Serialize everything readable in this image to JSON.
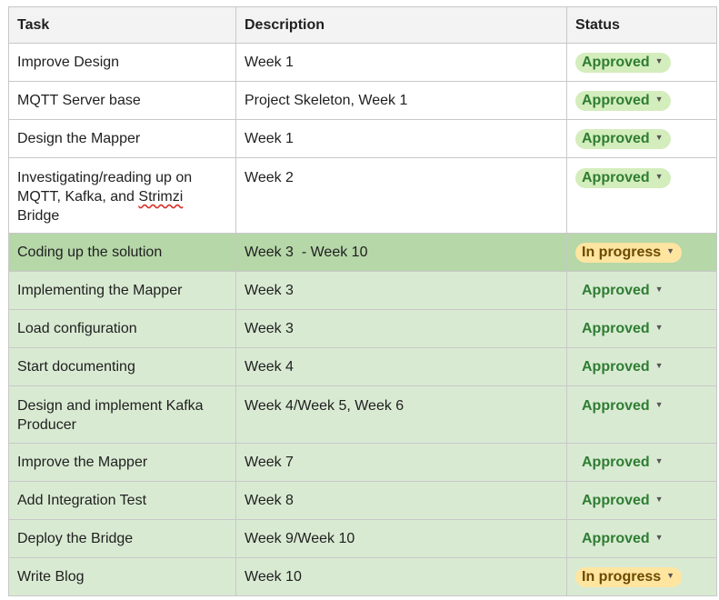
{
  "headers": {
    "task": "Task",
    "description": "Description",
    "status": "Status"
  },
  "rows": [
    {
      "task": "Improve Design",
      "description": "Week 1",
      "status": "Approved"
    },
    {
      "task": "MQTT Server base",
      "description": "Project Skeleton, Week 1",
      "status": "Approved"
    },
    {
      "task": "Design the Mapper",
      "description": "Week 1",
      "status": "Approved"
    },
    {
      "task_a": "Investigating/reading up on MQTT, Kafka, and ",
      "task_b": "Strimzi",
      "task_c": " Bridge",
      "description": "Week 2",
      "status": "Approved"
    },
    {
      "task": "Coding up the solution",
      "description": "Week 3  - Week 10",
      "status": "In progress"
    },
    {
      "task": "Implementing the Mapper",
      "description": "Week 3",
      "status": "Approved"
    },
    {
      "task": "Load configuration",
      "description": "Week 3",
      "status": "Approved"
    },
    {
      "task": "Start documenting",
      "description": "Week 4",
      "status": "Approved"
    },
    {
      "task": "Design and implement Kafka Producer",
      "description": "Week 4/Week 5, Week 6",
      "status": "Approved"
    },
    {
      "task": "Improve the Mapper",
      "description": "Week 7",
      "status": "Approved"
    },
    {
      "task": "Add Integration Test",
      "description": "Week 8",
      "status": "Approved"
    },
    {
      "task": "Deploy the Bridge",
      "description": "Week 9/Week 10",
      "status": "Approved"
    },
    {
      "task": "Write Blog",
      "description": "Week 10",
      "status": "In progress"
    }
  ],
  "colors": {
    "approved_chip": "#d4edbc",
    "in_progress_chip": "#ffe5a0",
    "highlight_row": "#d9ead3",
    "highlight_row_strong": "#b6d7a8"
  },
  "icons": {
    "dropdown": "chevron-down-icon"
  }
}
